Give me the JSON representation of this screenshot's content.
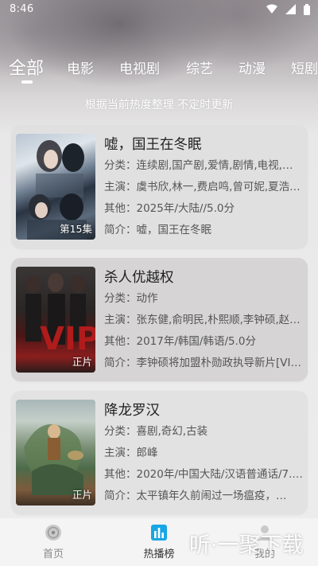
{
  "status": {
    "time": "8:46"
  },
  "tabs": [
    {
      "label": "全部"
    },
    {
      "label": "电影"
    },
    {
      "label": "电视剧"
    },
    {
      "label": "综艺"
    },
    {
      "label": "动漫"
    },
    {
      "label": "短剧"
    }
  ],
  "subtitle": "根据当前热度整理 不定时更新",
  "items": [
    {
      "title": "嘘，国王在冬眠",
      "category": "分类：连续剧,国产剧,爱情,剧情,电视,连续",
      "cast": "主演：虞书欣,林一,费启鸣,曾可妮,夏浩…",
      "other": "其他：2025年/大陆//5.0分",
      "intro": "简介：嘘，国王在冬眠",
      "badge": "第15集"
    },
    {
      "title": "杀人优越权",
      "category": "分类：动作",
      "cast": "主演：张东健,俞明民,朴熙顺,李钟硕,赵…",
      "other": "其他：2017年/韩国/韩语/5.0分",
      "intro": "简介：李钟硕将加盟朴勋政执导新片[VIP…",
      "badge": "正片"
    },
    {
      "title": "降龙罗汉",
      "category": "分类：喜剧,奇幻,古装",
      "cast": "主演：郎峰",
      "other": "其他：2020年/中国大陆/汉语普通话/7.0…",
      "intro": "简介：太平镇年久前闹过一场瘟疫，…",
      "badge": "正片"
    }
  ],
  "nav": [
    {
      "label": "首页",
      "icon": "home-icon"
    },
    {
      "label": "热播榜",
      "icon": "chart-icon"
    },
    {
      "label": "我的",
      "icon": "profile-icon"
    }
  ],
  "watermark": {
    "text": "听·一聚下载"
  },
  "colors": {
    "accent": "#1aa6e4",
    "card": "#e1e0e1"
  }
}
